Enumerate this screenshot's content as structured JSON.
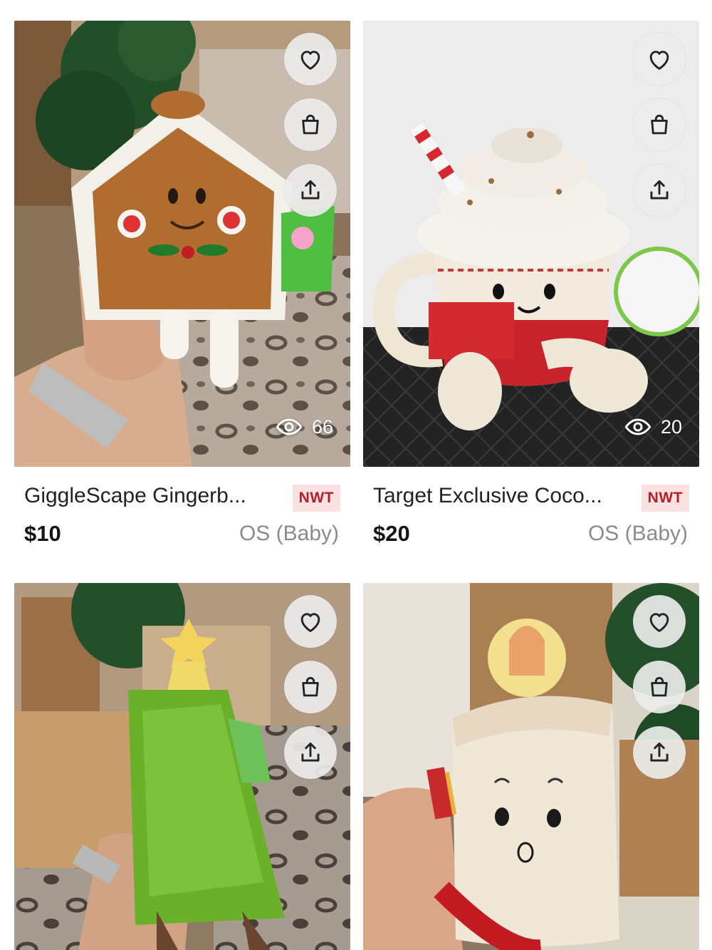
{
  "listings": [
    {
      "title": "GiggleScape Gingerb...",
      "badge": "NWT",
      "price": "$10",
      "size": "OS (Baby)",
      "views": "66",
      "icons": [
        "heart-icon",
        "shopping-bag-icon",
        "share-icon",
        "eye-icon"
      ]
    },
    {
      "title": "Target Exclusive Coco...",
      "badge": "NWT",
      "price": "$20",
      "size": "OS (Baby)",
      "views": "20",
      "icons": [
        "heart-icon",
        "shopping-bag-icon",
        "share-icon",
        "eye-icon"
      ]
    },
    {
      "icons": [
        "heart-icon",
        "shopping-bag-icon",
        "share-icon"
      ]
    },
    {
      "icons": [
        "heart-icon",
        "shopping-bag-icon",
        "share-icon"
      ]
    }
  ],
  "colors": {
    "badge_background": "#fbe1e1",
    "badge_text": "#b3202a",
    "size_text": "#8b8b8b",
    "action_button": "#ebebeb"
  }
}
